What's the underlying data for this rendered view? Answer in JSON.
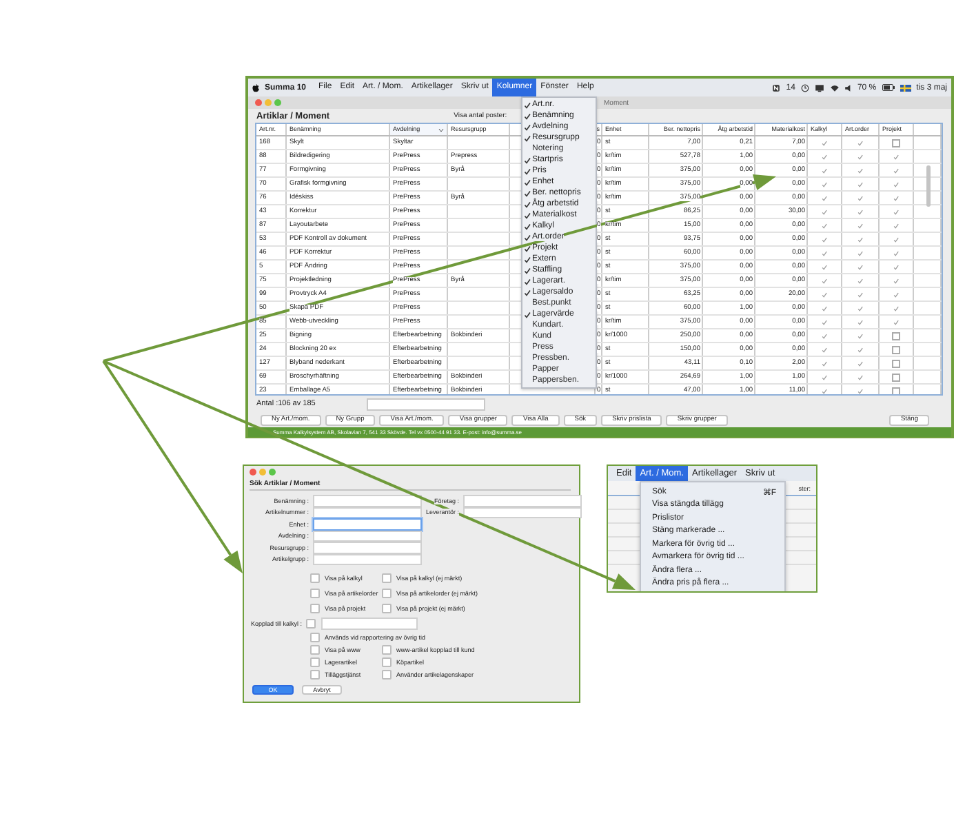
{
  "main_window": {
    "menu_bar": {
      "app": "Summa 10",
      "items": [
        {
          "label": "File",
          "selected": false
        },
        {
          "label": "Edit",
          "selected": false
        },
        {
          "label": "Art. / Mom.",
          "selected": false
        },
        {
          "label": "Artikellager",
          "selected": false
        },
        {
          "label": "Skriv ut",
          "selected": false
        },
        {
          "label": "Kolumner",
          "selected": true
        },
        {
          "label": "Fönster",
          "selected": false
        },
        {
          "label": "Help",
          "selected": false
        }
      ],
      "status": {
        "count": "14",
        "battery": "70 %",
        "clock": "tis 3 maj"
      }
    },
    "window_title": "Moment",
    "heading": "Artiklar / Moment",
    "show_count_label": "Visa antal poster:",
    "columns_menu": [
      {
        "label": "Art.nr.",
        "checked": true
      },
      {
        "label": "Benämning",
        "checked": true
      },
      {
        "label": "Avdelning",
        "checked": true
      },
      {
        "label": "Resursgrupp",
        "checked": true
      },
      {
        "label": "Notering",
        "checked": false
      },
      {
        "label": "Startpris",
        "checked": true
      },
      {
        "label": "Pris",
        "checked": true
      },
      {
        "label": "Enhet",
        "checked": true
      },
      {
        "label": "Ber. nettopris",
        "checked": true
      },
      {
        "label": "Åtg arbetstid",
        "checked": true
      },
      {
        "label": "Materialkost",
        "checked": true
      },
      {
        "label": "Kalkyl",
        "checked": true
      },
      {
        "label": "Art.order",
        "checked": true
      },
      {
        "label": "Projekt",
        "checked": true
      },
      {
        "label": "Extern",
        "checked": true
      },
      {
        "label": "Staffling",
        "checked": true
      },
      {
        "label": "Lagerart.",
        "checked": true
      },
      {
        "label": "Lagersaldo",
        "checked": true
      },
      {
        "label": "Best.punkt",
        "checked": false
      },
      {
        "label": "Lagervärde",
        "checked": true
      },
      {
        "label": "Kundart.",
        "checked": false
      },
      {
        "label": "Kund",
        "checked": false
      },
      {
        "label": "Press",
        "checked": false
      },
      {
        "label": "Pressben.",
        "checked": false
      },
      {
        "label": "Papper",
        "checked": false
      },
      {
        "label": "Pappersben.",
        "checked": false
      }
    ],
    "table": {
      "columns": [
        {
          "label": "Art.nr.",
          "kind": "text",
          "sorted": false
        },
        {
          "label": "Benämning",
          "kind": "text",
          "sorted": false
        },
        {
          "label": "Avdelning",
          "kind": "text",
          "sorted": true
        },
        {
          "label": "Resursgrupp",
          "kind": "text",
          "sorted": false
        },
        {
          "label": "s",
          "kind": "number",
          "sorted": false
        },
        {
          "label": "Enhet",
          "kind": "text",
          "sorted": false
        },
        {
          "label": "Ber. nettopris",
          "kind": "number",
          "sorted": false
        },
        {
          "label": "Åtg arbetstid",
          "kind": "number",
          "sorted": false
        },
        {
          "label": "Materialkost",
          "kind": "number",
          "sorted": false
        },
        {
          "label": "Kalkyl",
          "kind": "check",
          "sorted": false
        },
        {
          "label": "Art.order",
          "kind": "check",
          "sorted": false
        },
        {
          "label": "Projekt",
          "kind": "check",
          "sorted": false
        }
      ],
      "rows": [
        {
          "cells": [
            "168",
            "Skylt",
            "Skyltar",
            null,
            "0",
            "st",
            "7,00",
            "0,21",
            "7,00"
          ],
          "checks": [
            true,
            true,
            false
          ]
        },
        {
          "cells": [
            "88",
            "Bildredigering",
            "PrePress",
            "Prepress",
            "0",
            "kr/tim",
            "527,78",
            "1,00",
            "0,00"
          ],
          "checks": [
            true,
            true,
            true
          ]
        },
        {
          "cells": [
            "77",
            "Formgivning",
            "PrePress",
            "Byrå",
            "0",
            "kr/tim",
            "375,00",
            "0,00",
            "0,00"
          ],
          "checks": [
            true,
            true,
            true
          ]
        },
        {
          "cells": [
            "70",
            "Grafisk formgivning",
            "PrePress",
            null,
            "0",
            "kr/tim",
            "375,00",
            "0,00",
            "0,00"
          ],
          "checks": [
            true,
            true,
            true
          ]
        },
        {
          "cells": [
            "76",
            "Idéskiss",
            "PrePress",
            "Byrå",
            "0",
            "kr/tim",
            "375,00",
            "0,00",
            "0,00"
          ],
          "checks": [
            true,
            true,
            true
          ]
        },
        {
          "cells": [
            "43",
            "Korrektur",
            "PrePress",
            null,
            "0",
            "st",
            "86,25",
            "0,00",
            "30,00"
          ],
          "checks": [
            true,
            true,
            true
          ]
        },
        {
          "cells": [
            "87",
            "Layoutarbete",
            "PrePress",
            null,
            "0",
            "kr/tim",
            "15,00",
            "0,00",
            "0,00"
          ],
          "checks": [
            true,
            true,
            true
          ]
        },
        {
          "cells": [
            "53",
            "PDF Kontroll av dokument",
            "PrePress",
            null,
            "0",
            "st",
            "93,75",
            "0,00",
            "0,00"
          ],
          "checks": [
            true,
            true,
            true
          ]
        },
        {
          "cells": [
            "46",
            "PDF Korrektur",
            "PrePress",
            null,
            "0",
            "st",
            "60,00",
            "0,00",
            "0,00"
          ],
          "checks": [
            true,
            true,
            true
          ]
        },
        {
          "cells": [
            "5",
            "PDF Ändring",
            "PrePress",
            null,
            "0",
            "st",
            "375,00",
            "0,00",
            "0,00"
          ],
          "checks": [
            true,
            true,
            true
          ]
        },
        {
          "cells": [
            "75",
            "Projektledning",
            "PrePress",
            "Byrå",
            "0",
            "kr/tim",
            "375,00",
            "0,00",
            "0,00"
          ],
          "checks": [
            true,
            true,
            true
          ]
        },
        {
          "cells": [
            "99",
            "Provtryck A4",
            "PrePress",
            null,
            "0",
            "st",
            "63,25",
            "0,00",
            "20,00"
          ],
          "checks": [
            true,
            true,
            true
          ]
        },
        {
          "cells": [
            "50",
            "Skapa PDF",
            "PrePress",
            null,
            "0",
            "st",
            "60,00",
            "1,00",
            "0,00"
          ],
          "checks": [
            true,
            true,
            true
          ]
        },
        {
          "cells": [
            "85",
            "Webb-utveckling",
            "PrePress",
            null,
            "0",
            "kr/tim",
            "375,00",
            "0,00",
            "0,00"
          ],
          "checks": [
            true,
            true,
            true
          ]
        },
        {
          "cells": [
            "25",
            "Bigning",
            "Efterbearbetning",
            "Bokbinderi",
            "0",
            "kr/1000",
            "250,00",
            "0,00",
            "0,00"
          ],
          "checks": [
            true,
            true,
            false
          ]
        },
        {
          "cells": [
            "24",
            "Blockning 20 ex",
            "Efterbearbetning",
            null,
            "0",
            "st",
            "150,00",
            "0,00",
            "0,00"
          ],
          "checks": [
            true,
            true,
            false
          ]
        },
        {
          "cells": [
            "127",
            "Blyband nederkant",
            "Efterbearbetning",
            null,
            "0",
            "st",
            "43,11",
            "0,10",
            "2,00"
          ],
          "checks": [
            true,
            true,
            false
          ]
        },
        {
          "cells": [
            "69",
            "Broschyrhäftning",
            "Efterbearbetning",
            "Bokbinderi",
            "0",
            "kr/1000",
            "264,69",
            "1,00",
            "1,00"
          ],
          "checks": [
            true,
            true,
            false
          ]
        },
        {
          "cells": [
            "23",
            "Emballage A5",
            "Efterbearbetning",
            "Bokbinderi",
            "0",
            "st",
            "47,00",
            "1,00",
            "11,00"
          ],
          "checks": [
            true,
            true,
            false
          ]
        }
      ]
    },
    "count": "Antal :106 av 185",
    "buttons": [
      {
        "label": "Ny Art./mom.",
        "kind": "left"
      },
      {
        "label": "Ny Grupp",
        "kind": "left"
      },
      {
        "label": "Visa Art./mom.",
        "kind": "left"
      },
      {
        "label": "Visa grupper",
        "kind": "left"
      },
      {
        "label": "Visa Alla",
        "kind": "left"
      },
      {
        "label": "Sök",
        "kind": "left"
      },
      {
        "label": "Skriv prislista",
        "kind": "left"
      },
      {
        "label": "Skriv grupper",
        "kind": "left"
      },
      {
        "label": "Stäng",
        "kind": "right"
      }
    ],
    "footer": "Summa Kalkylsystem AB, Skolavian 7, 541 33 Skövde. Tel vx 0500-44 91 33. E-post: info@summa.se"
  },
  "search_dialog": {
    "title": "Sök Artiklar / Moment",
    "fields": [
      {
        "label": "Benämning :",
        "focused": false
      },
      {
        "label": "Artikelnummer :",
        "focused": false
      },
      {
        "label": "Enhet :",
        "focused": true
      },
      {
        "label": "Avdelning :",
        "focused": false
      },
      {
        "label": "Resursgrupp :",
        "focused": false
      },
      {
        "label": "Artikelgrupp :",
        "focused": false
      }
    ],
    "side_fields": [
      {
        "label": "Företag :"
      },
      {
        "label": "Leverantör :"
      }
    ],
    "options": [
      {
        "label": "Visa på kalkyl",
        "checked": false
      },
      {
        "label": "Visa på kalkyl (ej märkt)",
        "checked": false
      },
      {
        "label": "Visa på artikelorder",
        "checked": false
      },
      {
        "label": "Visa på artikelorder (ej märkt)",
        "checked": false
      },
      {
        "label": "Visa på projekt",
        "checked": false
      },
      {
        "label": "Visa på projekt (ej märkt)",
        "checked": false
      }
    ],
    "linked": {
      "label": "Kopplad till kalkyl :",
      "checked": false
    },
    "report_option": {
      "label": "Används vid rapportering av övrig tid",
      "checked": false
    },
    "extra_options": [
      {
        "label": "Visa på www",
        "checked": false
      },
      {
        "label": "www-artikel kopplad till kund",
        "checked": false
      },
      {
        "label": "Lagerartikel",
        "checked": false
      },
      {
        "label": "Köpartikel",
        "checked": false
      },
      {
        "label": "Tilläggstjänst",
        "checked": false
      },
      {
        "label": "Använder artikelagenskaper",
        "checked": false
      }
    ],
    "buttons": [
      {
        "label": "OK",
        "primary": true
      },
      {
        "label": "Avbryt",
        "primary": false
      }
    ]
  },
  "art_menu": {
    "menu_bar": [
      {
        "label": "Edit",
        "selected": false
      },
      {
        "label": "Art. / Mom.",
        "selected": true
      },
      {
        "label": "Artikellager",
        "selected": false
      },
      {
        "label": "Skriv ut",
        "selected": false
      }
    ],
    "items": [
      {
        "label": "Sök",
        "shortcut": "⌘F"
      },
      {
        "label": "Visa stängda tillägg"
      },
      {
        "label": "Prislistor"
      },
      {
        "label": "Stäng markerade ..."
      },
      {
        "label": "Markera för övrig tid ..."
      },
      {
        "label": "Avmarkera för övrig tid ..."
      },
      {
        "label": "Ändra flera ..."
      },
      {
        "label": "Ändra pris på flera ..."
      }
    ],
    "background_text": "ster:"
  }
}
